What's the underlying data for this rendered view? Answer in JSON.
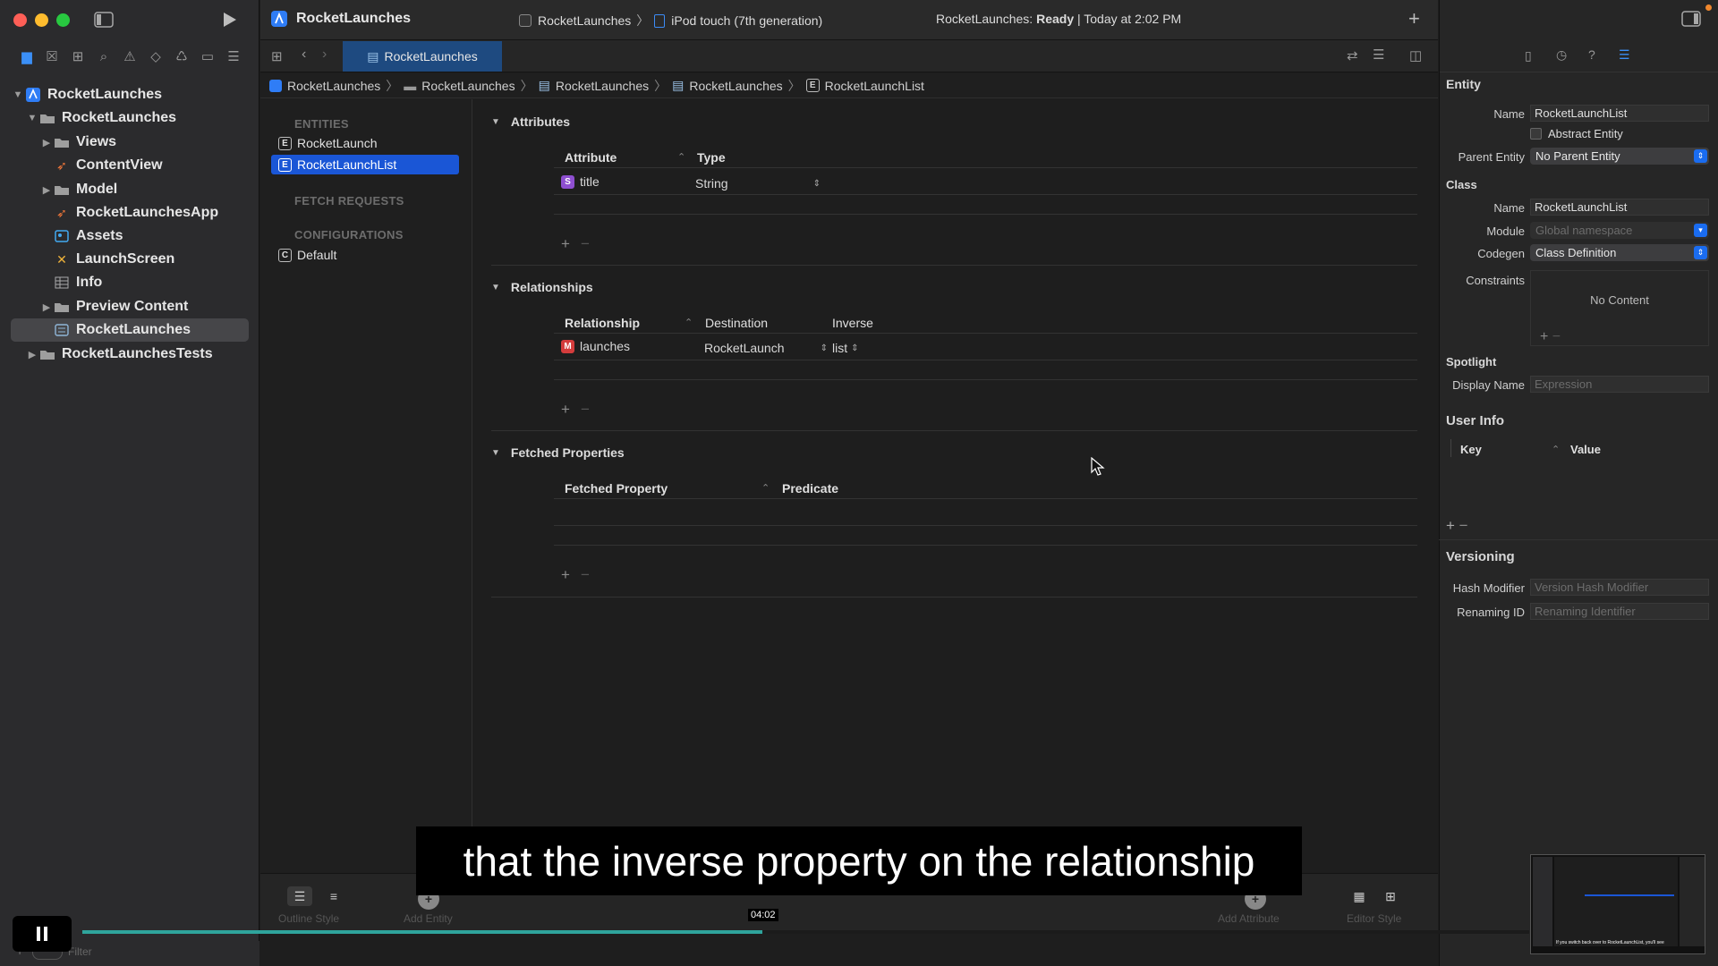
{
  "window": {
    "title": "RocketLaunches",
    "scheme": "RocketLaunches",
    "device": "iPod touch (7th generation)",
    "status_prefix": "RocketLaunches: ",
    "status_bold": "Ready",
    "status_suffix": " | Today at 2:02 PM"
  },
  "navigator": {
    "items": [
      {
        "label": "RocketLaunches",
        "icon": "project-icon"
      },
      {
        "label": "RocketLaunches",
        "icon": "folder-icon"
      },
      {
        "label": "Views",
        "icon": "folder-icon"
      },
      {
        "label": "ContentView",
        "icon": "swift-icon"
      },
      {
        "label": "Model",
        "icon": "folder-icon"
      },
      {
        "label": "RocketLaunchesApp",
        "icon": "swift-icon"
      },
      {
        "label": "Assets",
        "icon": "assets-icon"
      },
      {
        "label": "LaunchScreen",
        "icon": "storyboard-icon"
      },
      {
        "label": "Info",
        "icon": "plist-icon"
      },
      {
        "label": "Preview Content",
        "icon": "folder-icon"
      },
      {
        "label": "RocketLaunches",
        "icon": "datamodel-icon"
      },
      {
        "label": "RocketLaunchesTests",
        "icon": "folder-icon"
      }
    ],
    "filter_placeholder": "Filter"
  },
  "tab": {
    "label": "RocketLaunches"
  },
  "breadcrumb": [
    "RocketLaunches",
    "RocketLaunches",
    "RocketLaunches",
    "RocketLaunches",
    "RocketLaunchList"
  ],
  "entities_panel": {
    "entities_header": "ENTITIES",
    "entities": [
      {
        "badge": "E",
        "label": "RocketLaunch"
      },
      {
        "badge": "E",
        "label": "RocketLaunchList"
      }
    ],
    "fetch_header": "FETCH REQUESTS",
    "config_header": "CONFIGURATIONS",
    "configs": [
      {
        "badge": "C",
        "label": "Default"
      }
    ]
  },
  "attributes": {
    "title": "Attributes",
    "col_attribute": "Attribute",
    "col_type": "Type",
    "rows": [
      {
        "badge": "S",
        "name": "title",
        "type": "String"
      }
    ]
  },
  "relationships": {
    "title": "Relationships",
    "col_relationship": "Relationship",
    "col_destination": "Destination",
    "col_inverse": "Inverse",
    "rows": [
      {
        "badge": "M",
        "name": "launches",
        "destination": "RocketLaunch",
        "inverse": "list"
      }
    ]
  },
  "fetched": {
    "title": "Fetched Properties",
    "col_property": "Fetched Property",
    "col_predicate": "Predicate"
  },
  "inspector": {
    "entity_header": "Entity",
    "name_label": "Name",
    "name_value": "RocketLaunchList",
    "abstract_label": "Abstract Entity",
    "parent_label": "Parent Entity",
    "parent_value": "No Parent Entity",
    "class_header": "Class",
    "class_name_label": "Name",
    "class_name_value": "RocketLaunchList",
    "module_label": "Module",
    "module_placeholder": "Global namespace",
    "codegen_label": "Codegen",
    "codegen_value": "Class Definition",
    "constraints_label": "Constraints",
    "constraints_empty": "No Content",
    "spotlight_header": "Spotlight",
    "display_name_label": "Display Name",
    "display_name_placeholder": "Expression",
    "userinfo_header": "User Info",
    "key_col": "Key",
    "value_col": "Value",
    "versioning_header": "Versioning",
    "hash_label": "Hash Modifier",
    "hash_placeholder": "Version Hash Modifier",
    "renaming_label": "Renaming ID",
    "renaming_placeholder": "Renaming Identifier"
  },
  "bottom": {
    "outline_style": "Outline Style",
    "add_entity": "Add Entity",
    "add_attribute": "Add Attribute",
    "editor_style": "Editor Style"
  },
  "video": {
    "subtitle": "that the inverse property on the relationship",
    "time": "04:02",
    "progress": 0.47,
    "thumbnail_caption": "If you switch back over to RocketLaunchList, you'll see"
  },
  "colors": {
    "accent": "#1a56d6",
    "sidebar": "#2b2b2d",
    "editor": "#1e1e1e",
    "progress": "#2fa49c"
  }
}
